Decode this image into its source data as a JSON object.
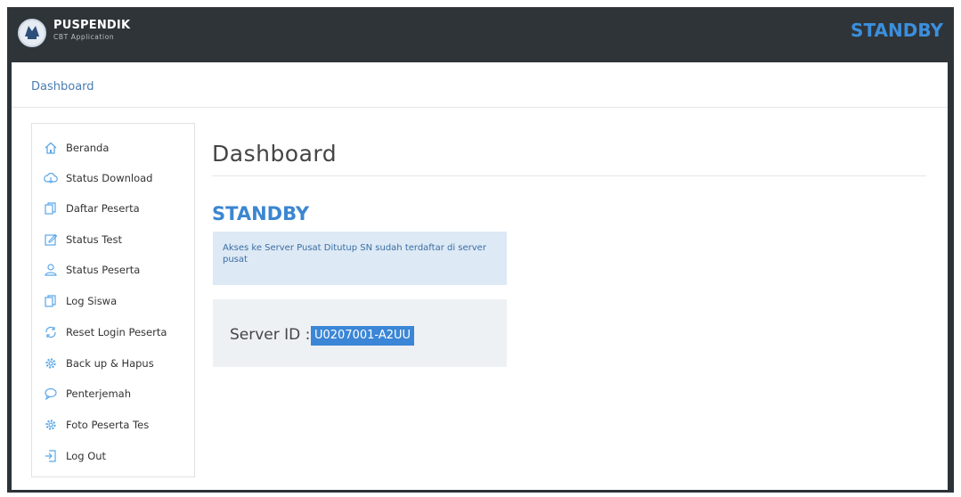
{
  "header": {
    "brand_name": "PUSPENDIK",
    "brand_sub": "CBT Application",
    "status": "STANDBY"
  },
  "breadcrumb": "Dashboard",
  "sidebar": {
    "items": [
      {
        "label": "Beranda",
        "icon": "home-icon"
      },
      {
        "label": "Status Download",
        "icon": "cloud-download-icon"
      },
      {
        "label": "Daftar Peserta",
        "icon": "copy-icon"
      },
      {
        "label": "Status Test",
        "icon": "edit-icon"
      },
      {
        "label": "Status Peserta",
        "icon": "user-icon"
      },
      {
        "label": "Log Siswa",
        "icon": "copy-icon"
      },
      {
        "label": "Reset Login Peserta",
        "icon": "refresh-icon"
      },
      {
        "label": "Back up & Hapus",
        "icon": "gear-icon"
      },
      {
        "label": "Penterjemah",
        "icon": "chat-icon"
      },
      {
        "label": "Foto Peserta Tes",
        "icon": "gear-icon"
      },
      {
        "label": "Log Out",
        "icon": "logout-icon"
      }
    ]
  },
  "main": {
    "title": "Dashboard",
    "status": "STANDBY",
    "notice": "Akses ke Server Pusat Ditutup SN sudah terdaftar di server pusat",
    "server_label": "Server ID :",
    "server_id": "U0207001-A2UU"
  },
  "colors": {
    "accent": "#3b86d1",
    "header_bg": "#2f3438",
    "notice_bg": "#dde9f5"
  }
}
